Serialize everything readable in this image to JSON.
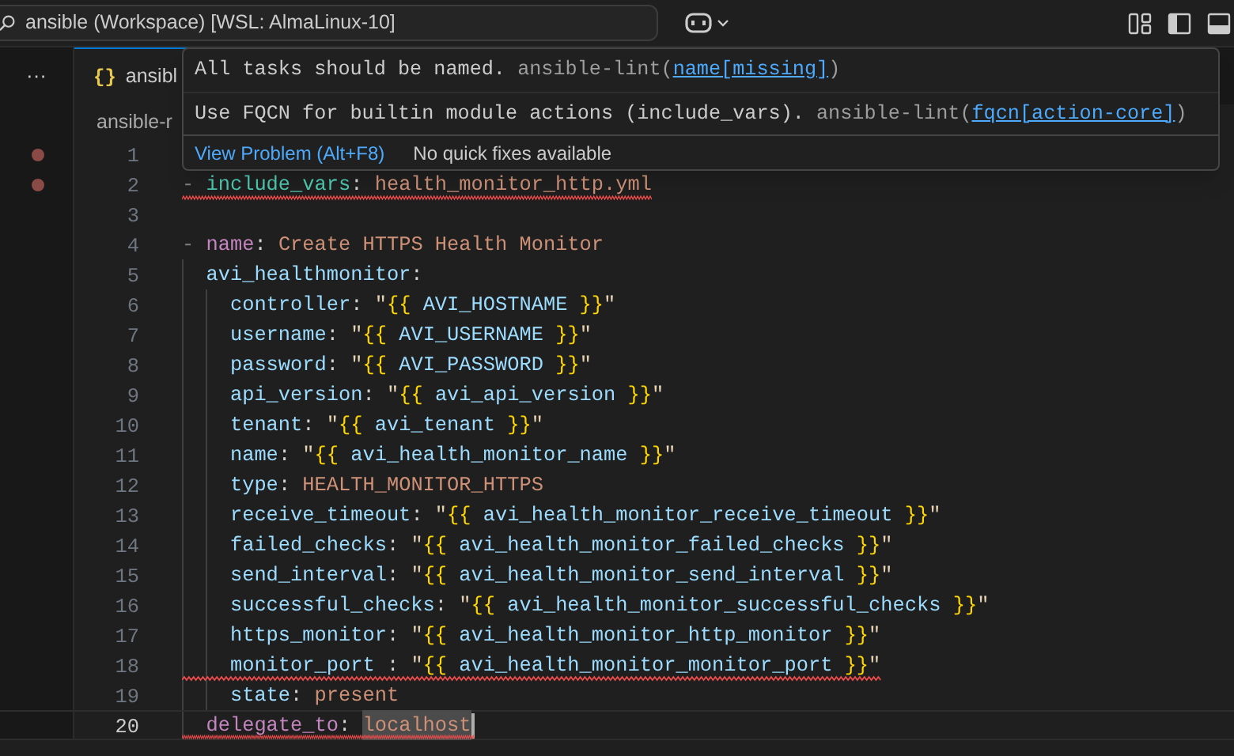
{
  "title_bar": {
    "search_text": "ansible (Workspace) [WSL: AlmaLinux-10]"
  },
  "activity_bar": {
    "more": "···"
  },
  "tab": {
    "icon_text": "{}",
    "label": "ansibl"
  },
  "breadcrumb": "ansible-r",
  "hover": {
    "problems": [
      {
        "message": "All tasks should be named.",
        "source": "ansible-lint(",
        "rule": "name[missing]",
        "suffix": ")"
      },
      {
        "message": "Use FQCN for builtin module actions (include_vars).",
        "source": "ansible-lint(",
        "rule": "fqcn[action-core]",
        "suffix": ")"
      }
    ],
    "actions": [
      {
        "kind": "link",
        "label": "View Problem (Alt+F8)"
      },
      {
        "kind": "note",
        "label": "No quick fixes available"
      }
    ]
  },
  "lines": [
    {
      "number": "1",
      "breakpoint": true,
      "error": false,
      "current": false
    },
    {
      "number": "2",
      "breakpoint": true,
      "error": true,
      "current": false,
      "tokens": [
        {
          "kind": "dash",
          "text": "- "
        },
        {
          "kind": "module",
          "text": "include_vars"
        },
        {
          "kind": "punct",
          "text": ": "
        },
        {
          "kind": "scalar",
          "text": "health_monitor_http.yml"
        }
      ]
    },
    {
      "number": "3",
      "breakpoint": false,
      "error": false,
      "current": false
    },
    {
      "number": "4",
      "breakpoint": false,
      "error": false,
      "current": false,
      "tokens": [
        {
          "kind": "dash",
          "text": "- "
        },
        {
          "kind": "keyword",
          "text": "name"
        },
        {
          "kind": "punct",
          "text": ": "
        },
        {
          "kind": "scalar",
          "text": "Create HTTPS Health Monitor"
        }
      ],
      "children": [
        {
          "number": "5",
          "breakpoint": false,
          "error": false,
          "current": false,
          "tokens": [
            {
              "kind": "key",
              "text": "avi_healthmonitor"
            },
            {
              "kind": "punct",
              "text": ":"
            }
          ],
          "children": [
            {
              "number": "6",
              "breakpoint": false,
              "error": false,
              "current": false,
              "tokens": [
                {
                  "kind": "key",
                  "text": "controller"
                },
                {
                  "kind": "punct",
                  "text": ": "
                },
                {
                  "kind": "quote",
                  "text": "\""
                },
                {
                  "kind": "brace",
                  "text": "{{"
                },
                {
                  "kind": "var",
                  "text": " AVI_HOSTNAME "
                },
                {
                  "kind": "brace",
                  "text": "}}"
                },
                {
                  "kind": "quote",
                  "text": "\""
                }
              ]
            },
            {
              "number": "7",
              "breakpoint": false,
              "error": false,
              "current": false,
              "tokens": [
                {
                  "kind": "key",
                  "text": "username"
                },
                {
                  "kind": "punct",
                  "text": ": "
                },
                {
                  "kind": "quote",
                  "text": "\""
                },
                {
                  "kind": "brace",
                  "text": "{{"
                },
                {
                  "kind": "var",
                  "text": " AVI_USERNAME "
                },
                {
                  "kind": "brace",
                  "text": "}}"
                },
                {
                  "kind": "quote",
                  "text": "\""
                }
              ]
            },
            {
              "number": "8",
              "breakpoint": false,
              "error": false,
              "current": false,
              "tokens": [
                {
                  "kind": "key",
                  "text": "password"
                },
                {
                  "kind": "punct",
                  "text": ": "
                },
                {
                  "kind": "quote",
                  "text": "\""
                },
                {
                  "kind": "brace",
                  "text": "{{"
                },
                {
                  "kind": "var",
                  "text": " AVI_PASSWORD "
                },
                {
                  "kind": "brace",
                  "text": "}}"
                },
                {
                  "kind": "quote",
                  "text": "\""
                }
              ]
            },
            {
              "number": "9",
              "breakpoint": false,
              "error": false,
              "current": false,
              "tokens": [
                {
                  "kind": "key",
                  "text": "api_version"
                },
                {
                  "kind": "punct",
                  "text": ": "
                },
                {
                  "kind": "quote",
                  "text": "\""
                },
                {
                  "kind": "brace",
                  "text": "{{"
                },
                {
                  "kind": "var",
                  "text": " avi_api_version "
                },
                {
                  "kind": "brace",
                  "text": "}}"
                },
                {
                  "kind": "quote",
                  "text": "\""
                }
              ]
            },
            {
              "number": "10",
              "breakpoint": false,
              "error": false,
              "current": false,
              "tokens": [
                {
                  "kind": "key",
                  "text": "tenant"
                },
                {
                  "kind": "punct",
                  "text": ": "
                },
                {
                  "kind": "quote",
                  "text": "\""
                },
                {
                  "kind": "brace",
                  "text": "{{"
                },
                {
                  "kind": "var",
                  "text": " avi_tenant "
                },
                {
                  "kind": "brace",
                  "text": "}}"
                },
                {
                  "kind": "quote",
                  "text": "\""
                }
              ]
            },
            {
              "number": "11",
              "breakpoint": false,
              "error": false,
              "current": false,
              "tokens": [
                {
                  "kind": "key",
                  "text": "name"
                },
                {
                  "kind": "punct",
                  "text": ": "
                },
                {
                  "kind": "quote",
                  "text": "\""
                },
                {
                  "kind": "brace",
                  "text": "{{"
                },
                {
                  "kind": "var",
                  "text": " avi_health_monitor_name "
                },
                {
                  "kind": "brace",
                  "text": "}}"
                },
                {
                  "kind": "quote",
                  "text": "\""
                }
              ]
            },
            {
              "number": "12",
              "breakpoint": false,
              "error": false,
              "current": false,
              "tokens": [
                {
                  "kind": "key",
                  "text": "type"
                },
                {
                  "kind": "punct",
                  "text": ": "
                },
                {
                  "kind": "scalar",
                  "text": "HEALTH_MONITOR_HTTPS"
                }
              ]
            },
            {
              "number": "13",
              "breakpoint": false,
              "error": false,
              "current": false,
              "tokens": [
                {
                  "kind": "key",
                  "text": "receive_timeout"
                },
                {
                  "kind": "punct",
                  "text": ": "
                },
                {
                  "kind": "quote",
                  "text": "\""
                },
                {
                  "kind": "brace",
                  "text": "{{"
                },
                {
                  "kind": "var",
                  "text": " avi_health_monitor_receive_timeout "
                },
                {
                  "kind": "brace",
                  "text": "}}"
                },
                {
                  "kind": "quote",
                  "text": "\""
                }
              ]
            },
            {
              "number": "14",
              "breakpoint": false,
              "error": false,
              "current": false,
              "tokens": [
                {
                  "kind": "key",
                  "text": "failed_checks"
                },
                {
                  "kind": "punct",
                  "text": ": "
                },
                {
                  "kind": "quote",
                  "text": "\""
                },
                {
                  "kind": "brace",
                  "text": "{{"
                },
                {
                  "kind": "var",
                  "text": " avi_health_monitor_failed_checks "
                },
                {
                  "kind": "brace",
                  "text": "}}"
                },
                {
                  "kind": "quote",
                  "text": "\""
                }
              ]
            },
            {
              "number": "15",
              "breakpoint": false,
              "error": false,
              "current": false,
              "tokens": [
                {
                  "kind": "key",
                  "text": "send_interval"
                },
                {
                  "kind": "punct",
                  "text": ": "
                },
                {
                  "kind": "quote",
                  "text": "\""
                },
                {
                  "kind": "brace",
                  "text": "{{"
                },
                {
                  "kind": "var",
                  "text": " avi_health_monitor_send_interval "
                },
                {
                  "kind": "brace",
                  "text": "}}"
                },
                {
                  "kind": "quote",
                  "text": "\""
                }
              ]
            },
            {
              "number": "16",
              "breakpoint": false,
              "error": false,
              "current": false,
              "tokens": [
                {
                  "kind": "key",
                  "text": "successful_checks"
                },
                {
                  "kind": "punct",
                  "text": ": "
                },
                {
                  "kind": "quote",
                  "text": "\""
                },
                {
                  "kind": "brace",
                  "text": "{{"
                },
                {
                  "kind": "var",
                  "text": " avi_health_monitor_successful_checks "
                },
                {
                  "kind": "brace",
                  "text": "}}"
                },
                {
                  "kind": "quote",
                  "text": "\""
                }
              ]
            },
            {
              "number": "17",
              "breakpoint": false,
              "error": false,
              "current": false,
              "tokens": [
                {
                  "kind": "key",
                  "text": "https_monitor"
                },
                {
                  "kind": "punct",
                  "text": ": "
                },
                {
                  "kind": "quote",
                  "text": "\""
                },
                {
                  "kind": "brace",
                  "text": "{{"
                },
                {
                  "kind": "var",
                  "text": " avi_health_monitor_http_monitor "
                },
                {
                  "kind": "brace",
                  "text": "}}"
                },
                {
                  "kind": "quote",
                  "text": "\""
                }
              ]
            },
            {
              "number": "18",
              "breakpoint": false,
              "error": true,
              "current": false,
              "tokens": [
                {
                  "kind": "key",
                  "text": "monitor_port"
                },
                {
                  "kind": "punct",
                  "text": " : "
                },
                {
                  "kind": "quote",
                  "text": "\""
                },
                {
                  "kind": "brace",
                  "text": "{{"
                },
                {
                  "kind": "var",
                  "text": " avi_health_monitor_monitor_port "
                },
                {
                  "kind": "brace",
                  "text": "}}"
                },
                {
                  "kind": "quote",
                  "text": "\""
                }
              ]
            },
            {
              "number": "19",
              "breakpoint": false,
              "error": false,
              "current": false,
              "tokens": [
                {
                  "kind": "key",
                  "text": "state"
                },
                {
                  "kind": "punct",
                  "text": ": "
                },
                {
                  "kind": "scalar",
                  "text": "present"
                }
              ]
            }
          ]
        },
        {
          "number": "20",
          "breakpoint": false,
          "error": true,
          "current": true,
          "tokens": [
            {
              "kind": "keyword",
              "text": "delegate_to"
            },
            {
              "kind": "punct",
              "text": ": "
            },
            {
              "kind": "selected",
              "text": "localhost"
            }
          ]
        }
      ]
    }
  ]
}
